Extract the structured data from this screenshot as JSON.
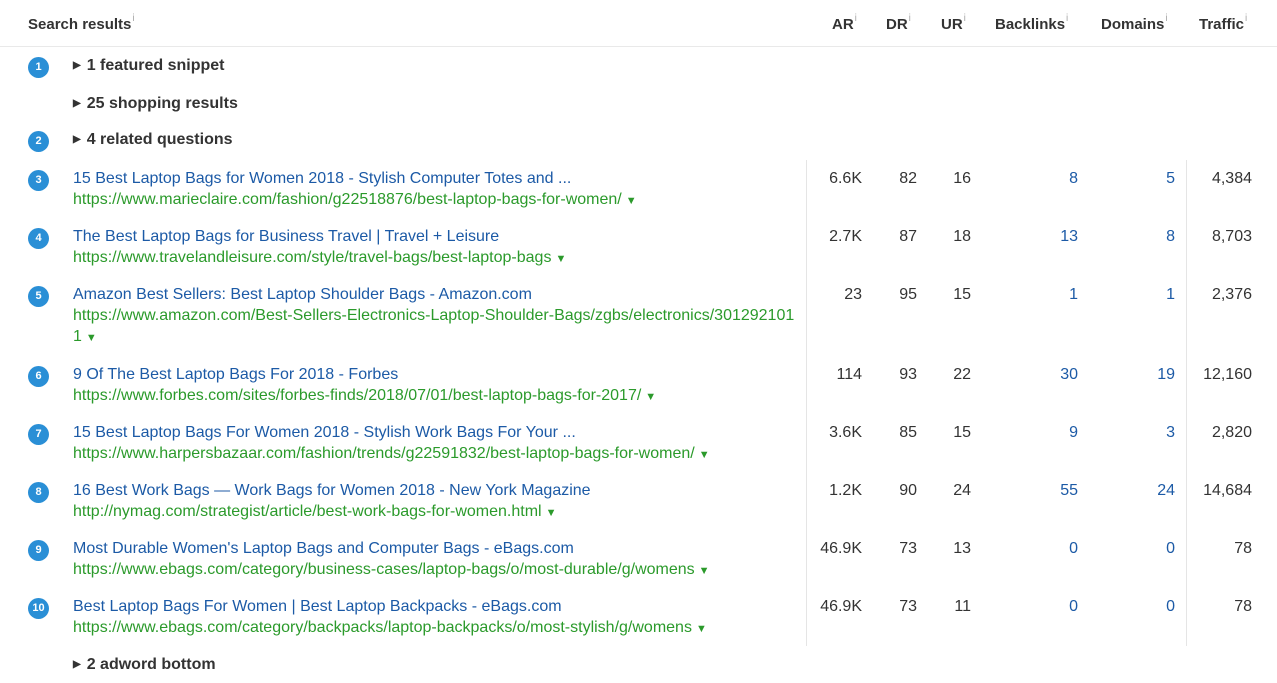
{
  "header": {
    "search_results": "Search results",
    "ar": "AR",
    "dr": "DR",
    "ur": "UR",
    "backlinks": "Backlinks",
    "domains": "Domains",
    "traffic": "Traffic",
    "info_glyph": "i"
  },
  "groups": {
    "featured": {
      "badge": "1",
      "label": "1 featured snippet"
    },
    "shopping": {
      "label": "25 shopping results"
    },
    "questions": {
      "badge": "2",
      "label": "4 related questions"
    },
    "adword": {
      "label": "2 adword bottom"
    }
  },
  "results": [
    {
      "rank": "3",
      "title": "15 Best Laptop Bags for Women 2018 - Stylish Computer Totes and ...",
      "url": "https://www.marieclaire.com/fashion/g22518876/best-laptop-bags-for-women/",
      "ar": "6.6K",
      "dr": "82",
      "ur": "16",
      "backlinks": "8",
      "domains": "5",
      "traffic": "4,384"
    },
    {
      "rank": "4",
      "title": "The Best Laptop Bags for Business Travel | Travel + Leisure",
      "url": "https://www.travelandleisure.com/style/travel-bags/best-laptop-bags",
      "ar": "2.7K",
      "dr": "87",
      "ur": "18",
      "backlinks": "13",
      "domains": "8",
      "traffic": "8,703"
    },
    {
      "rank": "5",
      "title": "Amazon Best Sellers: Best Laptop Shoulder Bags - Amazon.com",
      "url": "https://www.amazon.com/Best-Sellers-Electronics-Laptop-Shoulder-Bags/zgbs/electronics/3012921011",
      "ar": "23",
      "dr": "95",
      "ur": "15",
      "backlinks": "1",
      "domains": "1",
      "traffic": "2,376"
    },
    {
      "rank": "6",
      "title": "9 Of The Best Laptop Bags For 2018 - Forbes",
      "url": "https://www.forbes.com/sites/forbes-finds/2018/07/01/best-laptop-bags-for-2017/",
      "ar": "114",
      "dr": "93",
      "ur": "22",
      "backlinks": "30",
      "domains": "19",
      "traffic": "12,160"
    },
    {
      "rank": "7",
      "title": "15 Best Laptop Bags For Women 2018 - Stylish Work Bags For Your ...",
      "url": "https://www.harpersbazaar.com/fashion/trends/g22591832/best-laptop-bags-for-women/",
      "ar": "3.6K",
      "dr": "85",
      "ur": "15",
      "backlinks": "9",
      "domains": "3",
      "traffic": "2,820"
    },
    {
      "rank": "8",
      "title": "16 Best Work Bags — Work Bags for Women 2018 - New York Magazine",
      "url": "http://nymag.com/strategist/article/best-work-bags-for-women.html",
      "ar": "1.2K",
      "dr": "90",
      "ur": "24",
      "backlinks": "55",
      "domains": "24",
      "traffic": "14,684"
    },
    {
      "rank": "9",
      "title": "Most Durable Women's Laptop Bags and Computer Bags - eBags.com",
      "url": "https://www.ebags.com/category/business-cases/laptop-bags/o/most-durable/g/womens",
      "ar": "46.9K",
      "dr": "73",
      "ur": "13",
      "backlinks": "0",
      "domains": "0",
      "traffic": "78"
    },
    {
      "rank": "10",
      "title": "Best Laptop Bags For Women | Best Laptop Backpacks - eBags.com",
      "url": "https://www.ebags.com/category/backpacks/laptop-backpacks/o/most-stylish/g/womens",
      "ar": "46.9K",
      "dr": "73",
      "ur": "11",
      "backlinks": "0",
      "domains": "0",
      "traffic": "78"
    }
  ],
  "colors": {
    "badge": "#2a8fd6",
    "title_link": "#1c5aa6",
    "url": "#2b9a2b"
  },
  "icons": {
    "expand": "triangle-right-icon",
    "url_menu": "triangle-down-icon"
  }
}
